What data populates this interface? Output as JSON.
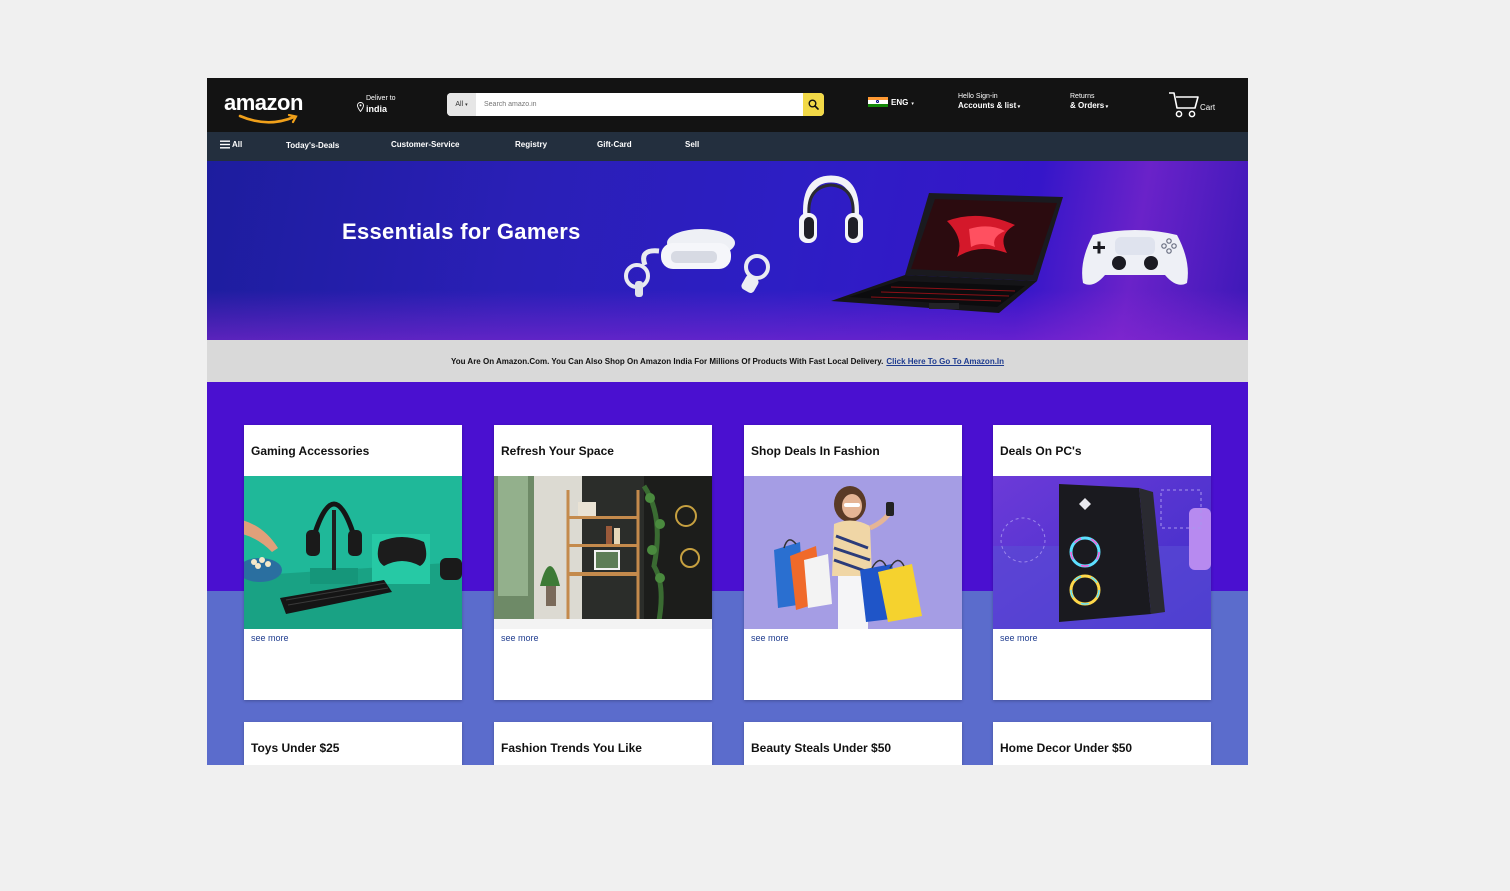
{
  "header": {
    "logo_text": "amazon",
    "deliver_label": "Deliver to",
    "deliver_location": "india",
    "search": {
      "category": "All",
      "placeholder": "Search amazo.in"
    },
    "language": "ENG",
    "account": {
      "greeting": "Hello Sign-in",
      "label": "Accounts & list"
    },
    "returns": {
      "line1": "Returns",
      "line2": "& Orders"
    },
    "cart_label": "Cart"
  },
  "nav": {
    "all_label": "All",
    "items": [
      "Today's-Deals",
      "Customer-Service",
      "Registry",
      "Gift-Card",
      "Sell"
    ]
  },
  "hero": {
    "title": "Essentials for Gamers"
  },
  "notice": {
    "text": "You Are On Amazon.Com. You Can Also Shop On Amazon India For Millions Of Products With Fast Local Delivery.",
    "link": "Click Here To Go To Amazon.In"
  },
  "cards_row1": [
    {
      "title": "Gaming Accessories",
      "link": "see more"
    },
    {
      "title": "Refresh Your Space",
      "link": "see more"
    },
    {
      "title": "Shop Deals In Fashion",
      "link": "see more"
    },
    {
      "title": "Deals On PC's",
      "link": "see more"
    }
  ],
  "cards_row2": [
    {
      "title": "Toys Under $25"
    },
    {
      "title": "Fashion Trends You Like"
    },
    {
      "title": "Beauty Steals Under $50"
    },
    {
      "title": "Home Decor Under $50"
    }
  ],
  "colors": {
    "header_bg": "#131313",
    "nav_bg": "#232f3e",
    "search_button": "#f2d947",
    "logo_smile": "#f0a01a",
    "link": "#1f3c8f",
    "page_purple": "#4a10d0",
    "lower_band": "#5b6ccc"
  }
}
